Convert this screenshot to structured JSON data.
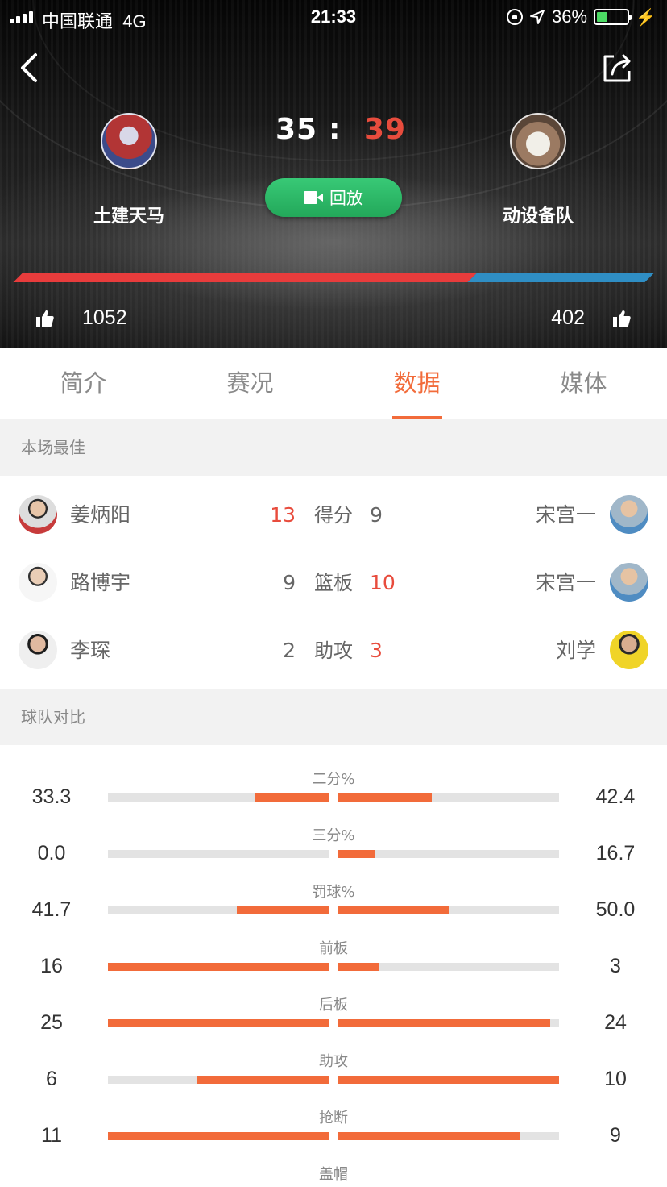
{
  "status_bar": {
    "carrier": "中国联通",
    "network": "4G",
    "time": "21:33",
    "battery": "36%",
    "battery_level": 0.36
  },
  "match": {
    "home": {
      "name": "土建天马",
      "score": "35",
      "likes": "1052"
    },
    "away": {
      "name": "动设备队",
      "score": "39",
      "likes": "402"
    },
    "separator": ":",
    "replay_label": "回放",
    "support_share_home": 0.72
  },
  "tabs": [
    {
      "label": "简介"
    },
    {
      "label": "赛况"
    },
    {
      "label": "数据"
    },
    {
      "label": "媒体"
    }
  ],
  "best": {
    "title": "本场最佳",
    "rows": [
      {
        "stat": "得分",
        "home_player": "姜炳阳",
        "home_value": "13",
        "away_value": "9",
        "away_player": "宋宫一"
      },
      {
        "stat": "篮板",
        "home_player": "路博宇",
        "home_value": "9",
        "away_value": "10",
        "away_player": "宋宫一"
      },
      {
        "stat": "助攻",
        "home_player": "李琛",
        "home_value": "2",
        "away_value": "3",
        "away_player": "刘学"
      }
    ]
  },
  "compare": {
    "title": "球队对比",
    "rows": [
      {
        "label": "二分%",
        "home": "33.3",
        "away": "42.4",
        "home_ratio": 0.333,
        "away_ratio": 0.424
      },
      {
        "label": "三分%",
        "home": "0.0",
        "away": "16.7",
        "home_ratio": 0.0,
        "away_ratio": 0.167
      },
      {
        "label": "罚球%",
        "home": "41.7",
        "away": "50.0",
        "home_ratio": 0.417,
        "away_ratio": 0.5
      },
      {
        "label": "前板",
        "home": "16",
        "away": "3",
        "home_ratio": 1.0,
        "away_ratio": 0.19
      },
      {
        "label": "后板",
        "home": "25",
        "away": "24",
        "home_ratio": 1.0,
        "away_ratio": 0.96
      },
      {
        "label": "助攻",
        "home": "6",
        "away": "10",
        "home_ratio": 0.6,
        "away_ratio": 1.0
      },
      {
        "label": "抢断",
        "home": "11",
        "away": "9",
        "home_ratio": 1.0,
        "away_ratio": 0.82
      },
      {
        "label": "盖帽",
        "home": "",
        "away": "",
        "home_ratio": 0,
        "away_ratio": 0
      }
    ]
  },
  "colors": {
    "accent": "#f26b3a",
    "home_red": "#e83c3c",
    "away_blue": "#2f8ec4",
    "replay_green": "#2bb866",
    "highlight": "#e84c3d"
  }
}
